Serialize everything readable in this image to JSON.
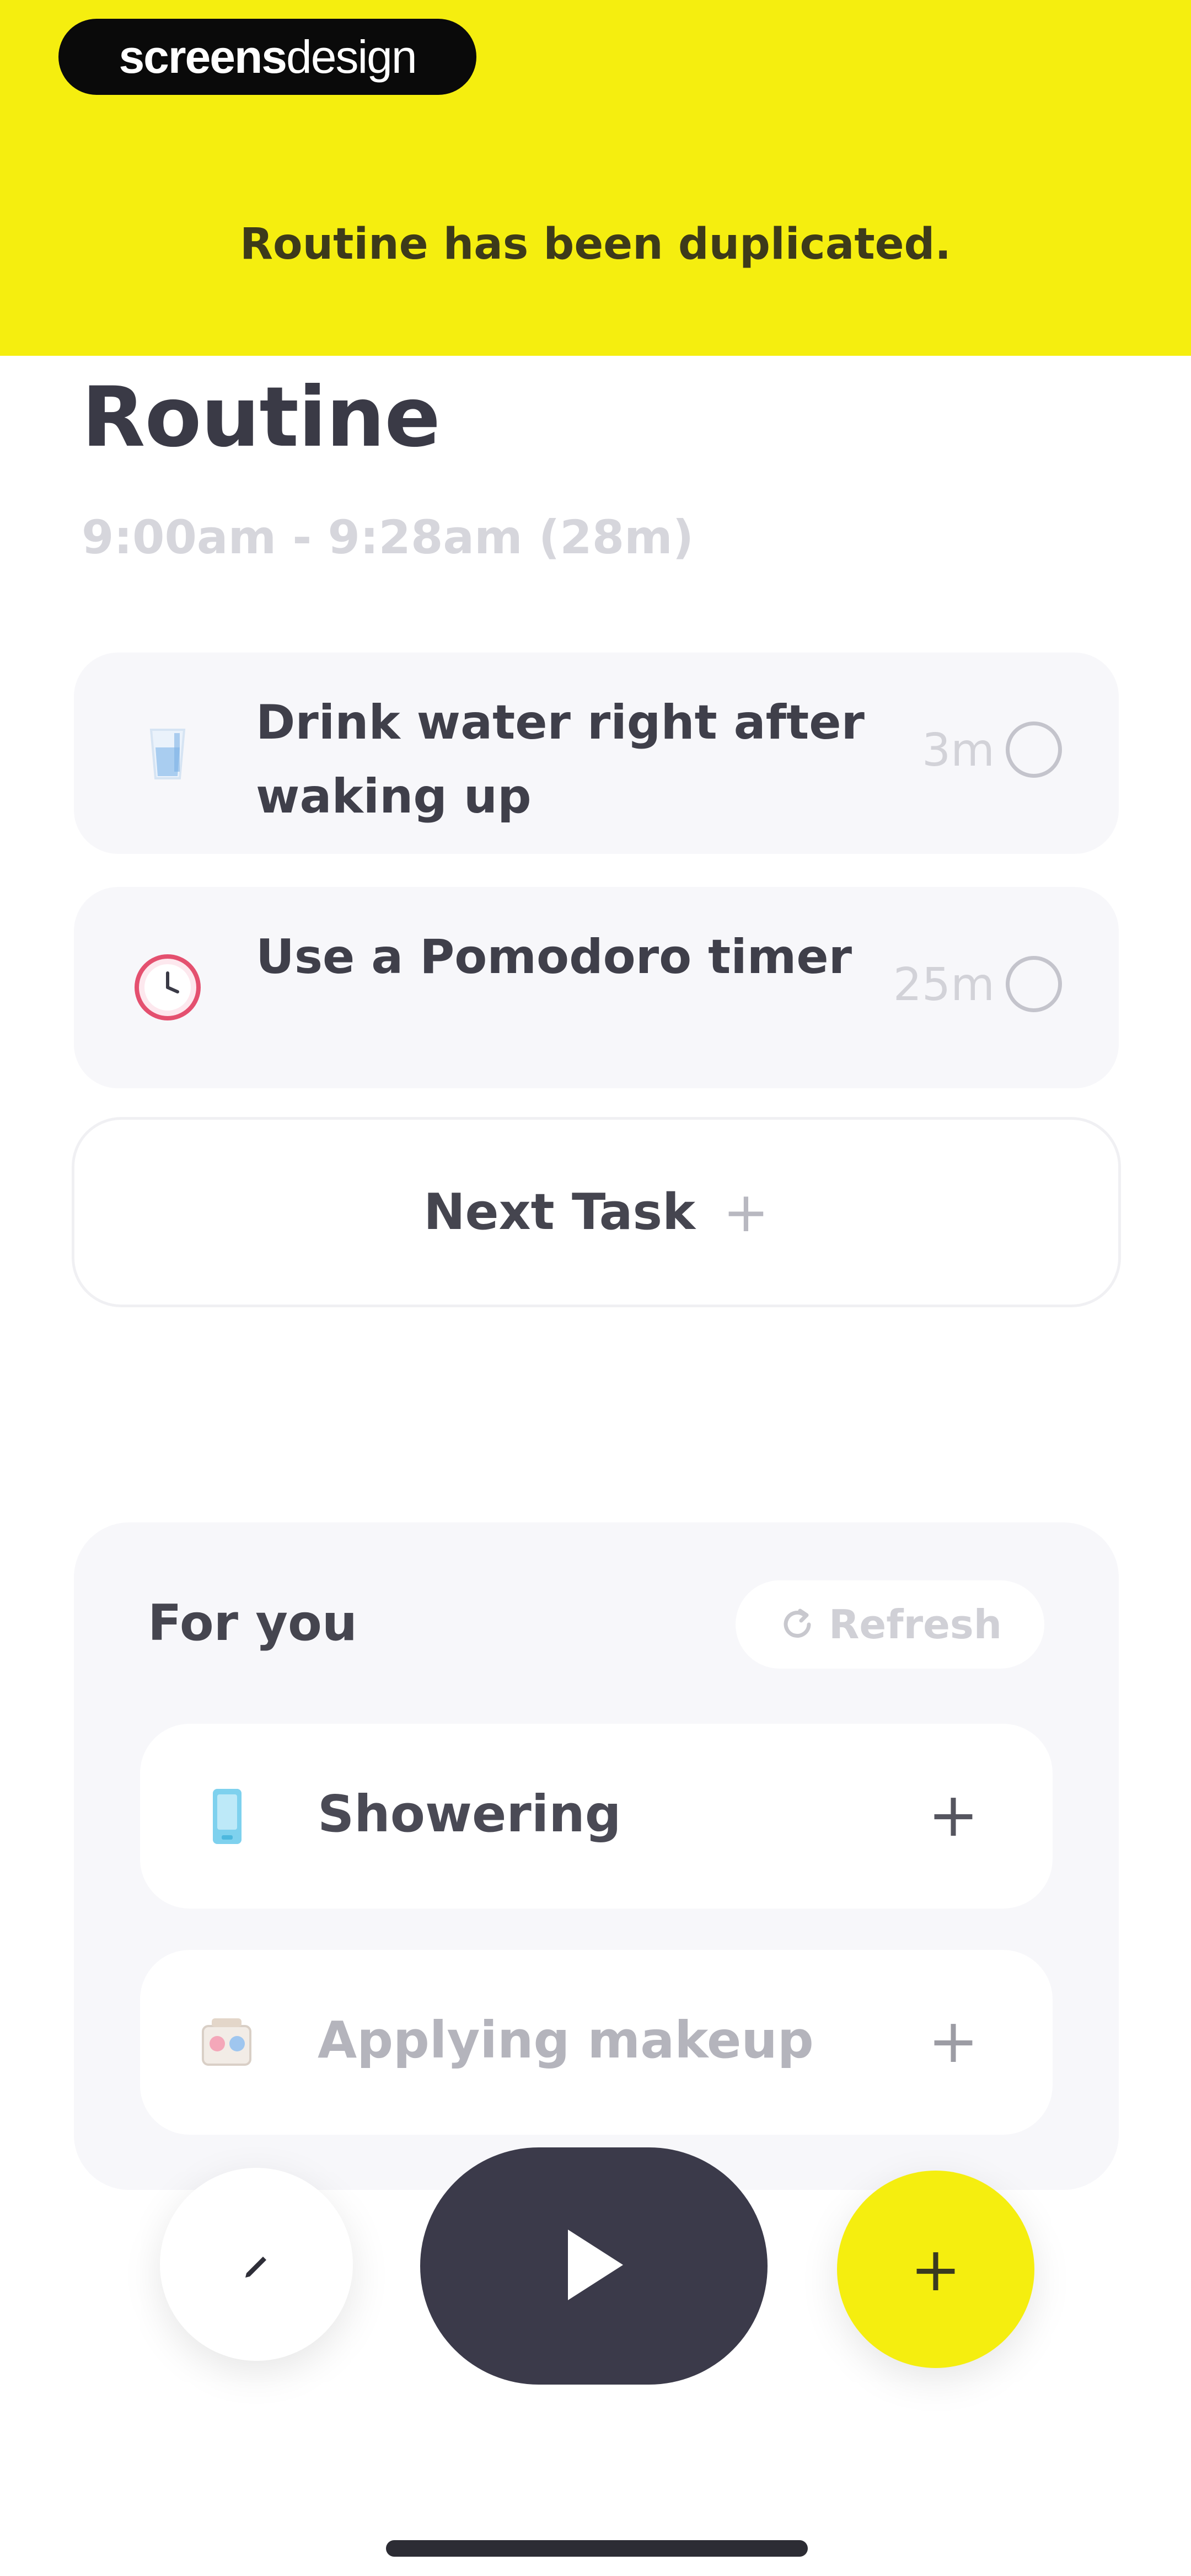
{
  "toast": {
    "brand_bold": "screens",
    "brand_light": "design",
    "message": "Routine has been duplicated."
  },
  "routine": {
    "title": "Routine",
    "time_range": "9:00am - 9:28am (28m)",
    "tasks": [
      {
        "name": "Drink water right after waking up",
        "duration": "3m",
        "icon": "water-glass-icon",
        "completed": false
      },
      {
        "name": "Use a Pomodoro timer",
        "duration": "25m",
        "icon": "clock-icon",
        "completed": false
      }
    ],
    "next_task_label": "Next Task"
  },
  "for_you": {
    "title": "For you",
    "refresh_label": "Refresh",
    "suggestions": [
      {
        "name": "Showering",
        "icon": "shower-icon"
      },
      {
        "name": "Applying makeup",
        "icon": "makeup-icon"
      }
    ]
  },
  "actions": {
    "edit_icon": "pencil-icon",
    "play_icon": "play-icon",
    "add_icon": "plus-icon"
  },
  "colors": {
    "accent_yellow": "#f5ee0f",
    "dark": "#3b3a4a",
    "card_bg": "#f7f7fa"
  }
}
